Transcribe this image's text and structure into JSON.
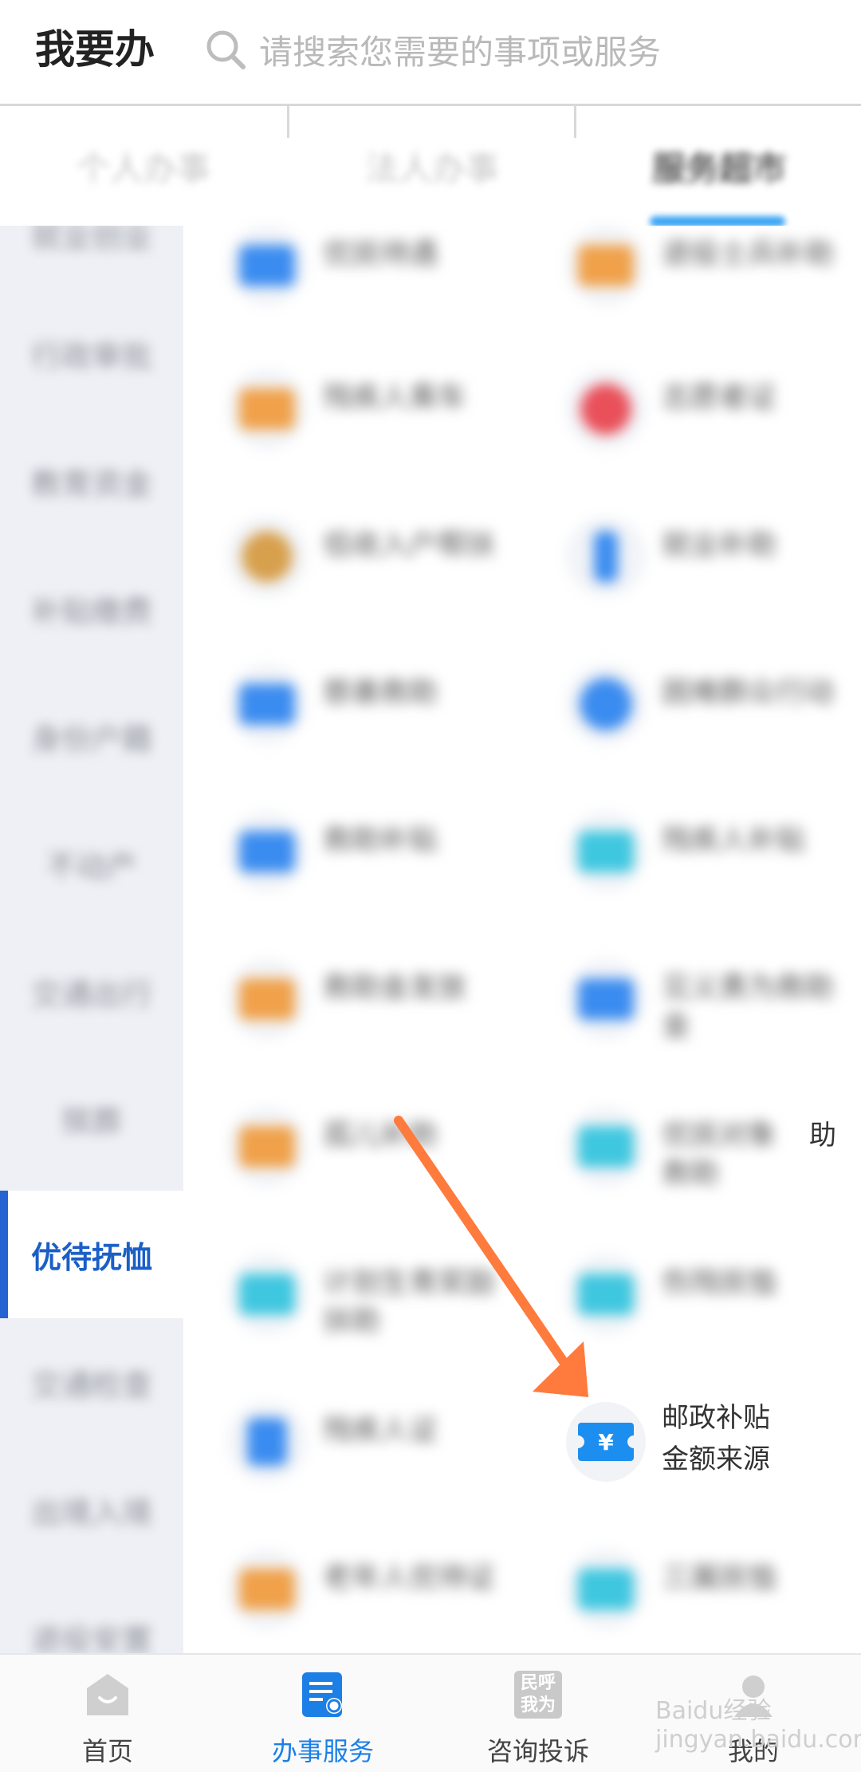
{
  "header": {
    "title": "我要办",
    "search_placeholder": "请搜索您需要的事项或服务"
  },
  "tabs": [
    {
      "label": "个人办事"
    },
    {
      "label": "法人办事"
    },
    {
      "label": "服务超市"
    }
  ],
  "sidebar": {
    "items": [
      {
        "label": "就业创业"
      },
      {
        "label": "行政审批"
      },
      {
        "label": "教育资金"
      },
      {
        "label": "补贴缴费"
      },
      {
        "label": "身份户籍"
      },
      {
        "label": "不动产"
      },
      {
        "label": "交通出行"
      },
      {
        "label": "殡葬"
      },
      {
        "label": "优待抚恤"
      },
      {
        "label": "交通检查"
      },
      {
        "label": "出境入境"
      },
      {
        "label": "退役安置"
      }
    ],
    "selected": "优待抚恤"
  },
  "grid": {
    "items": [
      {
        "label": "优抚待遇",
        "icon": "document-icon",
        "color": "#3b8cf0"
      },
      {
        "label": "退役士兵补助",
        "icon": "document-icon",
        "color": "#f0a14a"
      },
      {
        "label": "残疾人乘车",
        "icon": "bus-icon",
        "color": "#f0a14a"
      },
      {
        "label": "志愿者证",
        "icon": "location-icon",
        "color": "#e9505a"
      },
      {
        "label": "低收入户帮扶",
        "icon": "money-bag-icon",
        "color": "#d7a04d"
      },
      {
        "label": "就业补助",
        "icon": "person-icon",
        "color": "#3b8cf0"
      },
      {
        "label": "慈善救助",
        "icon": "hand-icon",
        "color": "#3b8cf0"
      },
      {
        "label": "困难群众行动",
        "icon": "globe-icon",
        "color": "#3b8cf0"
      },
      {
        "label": "救助补贴",
        "icon": "card-icon",
        "color": "#3b8cf0"
      },
      {
        "label": "残疾人补贴",
        "icon": "yuan-ticket-icon",
        "color": "#3fc7e0"
      },
      {
        "label": "救助金发放",
        "icon": "yuan-ticket-icon",
        "color": "#f0a14a"
      },
      {
        "label": "见义勇为救助金",
        "icon": "yuan-ticket-icon",
        "color": "#3b8cf0"
      },
      {
        "label": "孤儿补助",
        "icon": "yuan-ticket-icon",
        "color": "#f0a14a"
      },
      {
        "label": "优抚对象救助",
        "icon": "yuan-ticket-icon",
        "color": "#3fc7e0"
      },
      {
        "label": "计划生育奖励扶助",
        "icon": "yuan-ticket-icon",
        "color": "#3fc7e0"
      },
      {
        "label": "伤残抚恤",
        "icon": "shield-icon",
        "color": "#3fc7e0"
      },
      {
        "label": "残疾人证",
        "icon": "wheelchair-icon",
        "color": "#3b8cf0"
      },
      {
        "label": "邮政补贴金额来源",
        "icon": "yuan-ticket-icon",
        "color": "#1c8ef0"
      },
      {
        "label": "老年人优待证",
        "icon": "document-icon",
        "color": "#f0a14a"
      },
      {
        "label": "三属抚恤",
        "icon": "document-icon",
        "color": "#3fc7e0"
      }
    ],
    "highlighted_label_line1": "邮政补贴",
    "highlighted_label_line2": "金额来源",
    "partial_visible_text": "助"
  },
  "bottom_nav": {
    "items": [
      {
        "label": "首页",
        "icon": "home-icon"
      },
      {
        "label": "办事服务",
        "icon": "service-icon"
      },
      {
        "label": "咨询投诉",
        "icon": "consult-icon"
      },
      {
        "label": "我的",
        "icon": "user-icon"
      }
    ],
    "selected": "办事服务",
    "consult_icon_text": "民呼我为",
    "accent_color": "#1c7fe6"
  },
  "watermark": "Baidu经验 jingyan.baidu.com"
}
